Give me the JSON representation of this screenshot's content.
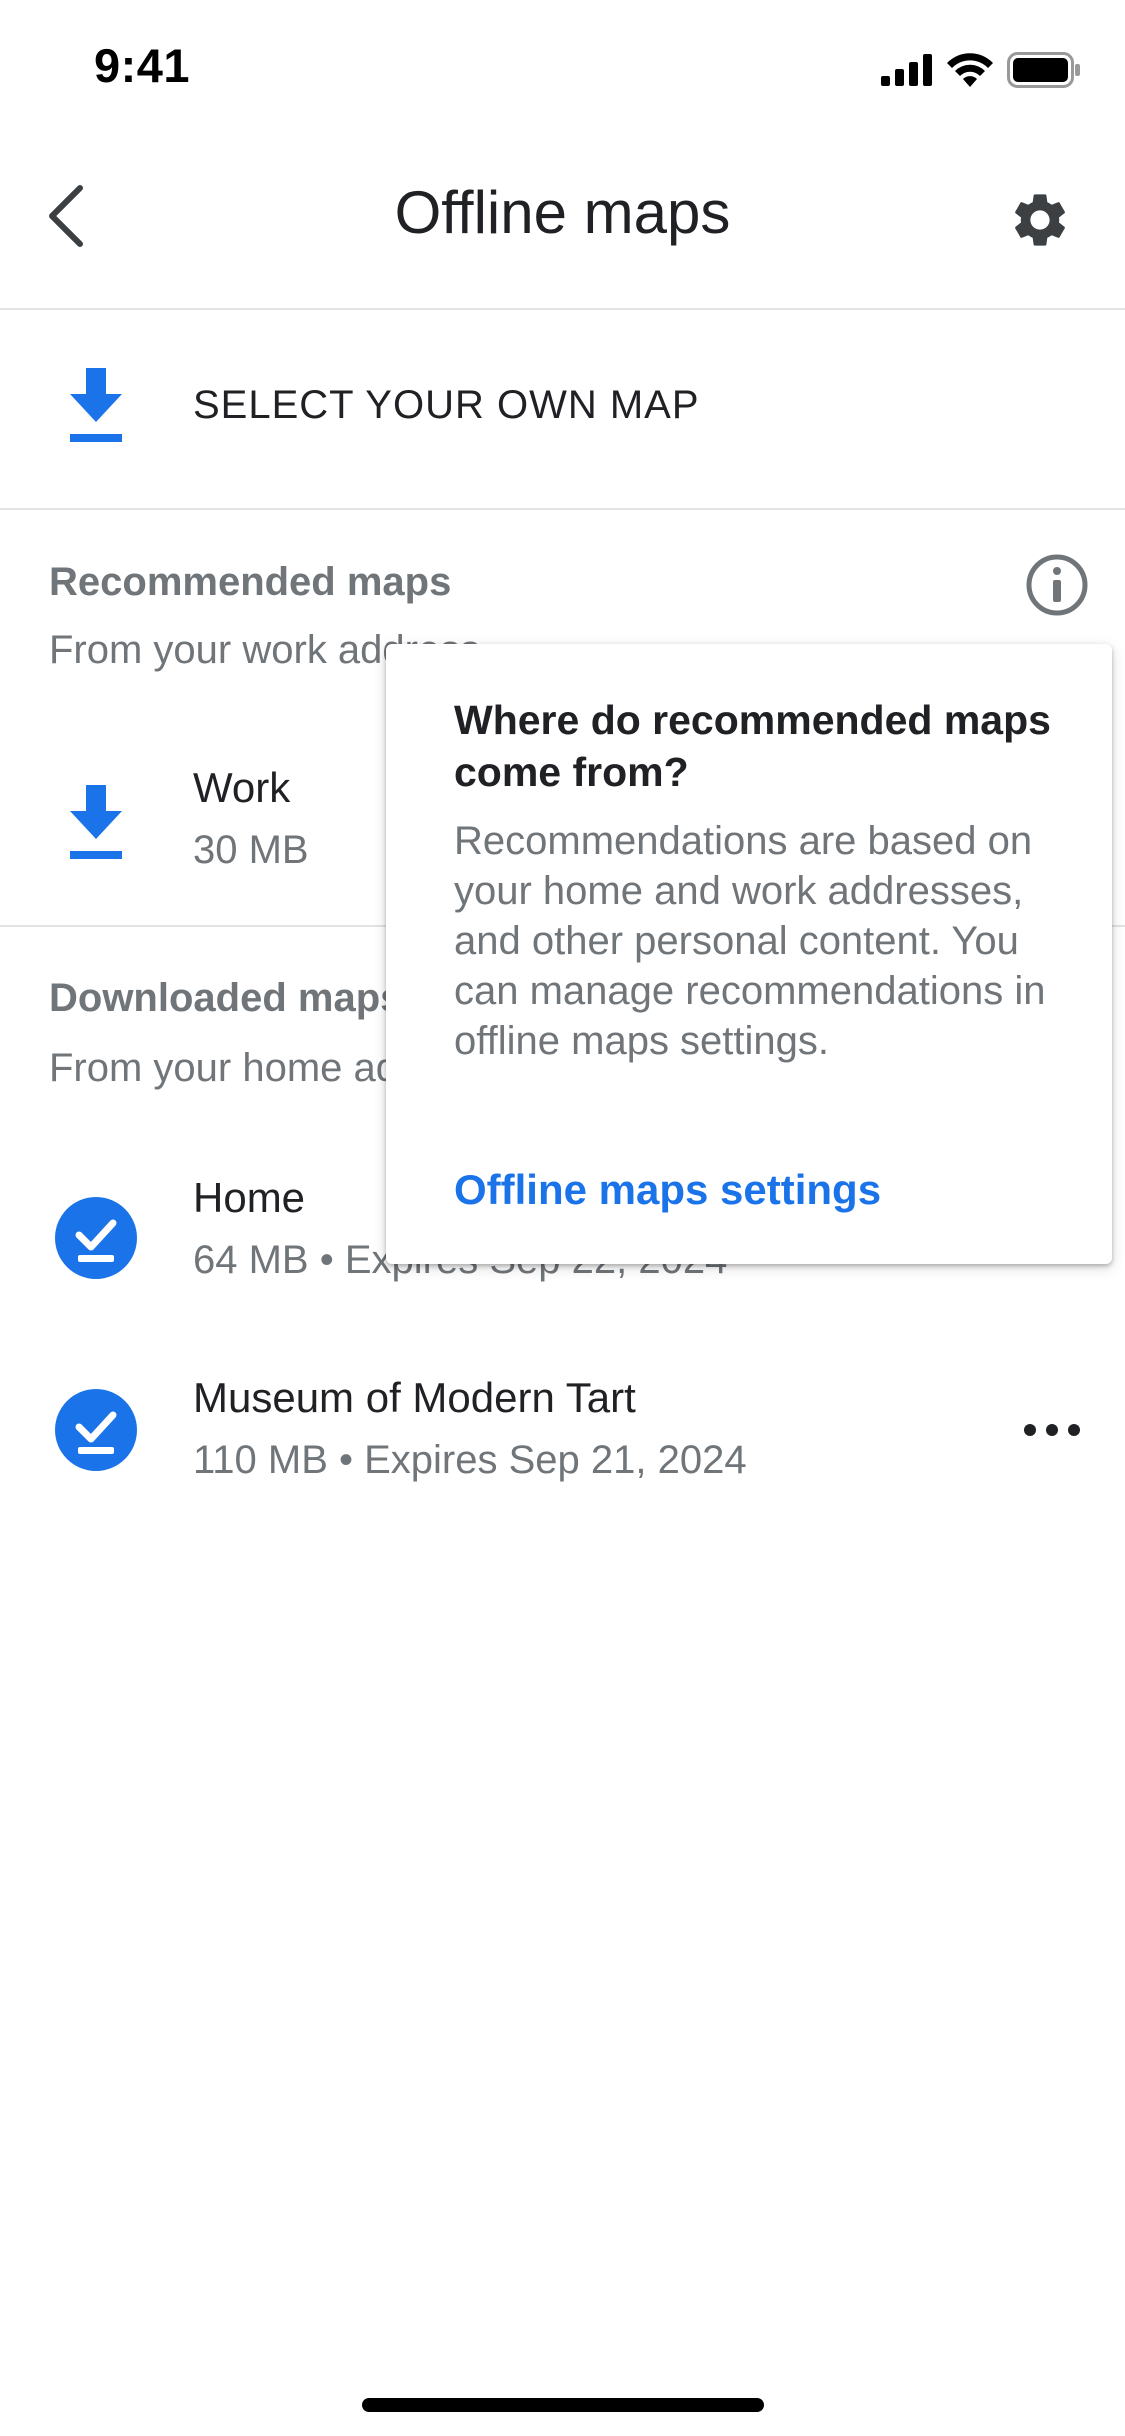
{
  "status_bar": {
    "time": "9:41",
    "icons": [
      "signal-icon",
      "wifi-icon",
      "battery-icon"
    ]
  },
  "header": {
    "title": "Offline maps",
    "back_icon": "chevron-left-icon",
    "settings_icon": "gear-icon"
  },
  "select_own_map": {
    "label": "SELECT YOUR OWN MAP",
    "icon": "download-icon"
  },
  "recommended": {
    "title": "Recommended maps",
    "subtitle": "From your work address",
    "info_icon": "info-icon",
    "items": [
      {
        "name": "Work",
        "meta": "30 MB",
        "icon": "download-icon"
      }
    ]
  },
  "downloaded": {
    "title": "Downloaded maps",
    "subtitle": "From your home address",
    "items": [
      {
        "name": "Home",
        "meta": "64 MB • Expires Sep 22, 2024",
        "icon": "check-download-icon"
      },
      {
        "name": "Museum of Modern Tart",
        "meta": "110 MB • Expires Sep 21, 2024",
        "icon": "check-download-icon",
        "menu_icon": "more-horizontal-icon"
      }
    ]
  },
  "popover": {
    "title": "Where do recommended maps come from?",
    "body": "Recommendations are based on your home and work addresses, and other personal content. You can manage recommendations in offline maps settings.",
    "link": "Offline maps settings"
  },
  "colors": {
    "accent": "#1a73e8",
    "text_primary": "#202124",
    "text_secondary": "#70757a",
    "divider": "#e3e3e3"
  }
}
